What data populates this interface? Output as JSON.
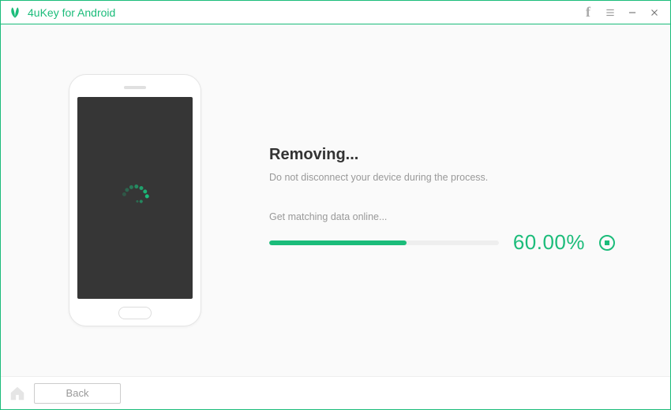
{
  "app": {
    "title": "4uKey for Android"
  },
  "titlebar": {
    "facebook": "f"
  },
  "main": {
    "heading": "Removing...",
    "subtext": "Do not disconnect your device during the process.",
    "status": "Get matching data online...",
    "progress_percent": 60.0,
    "progress_label": "60.00%"
  },
  "footer": {
    "back_label": "Back"
  },
  "colors": {
    "accent": "#1bbc7a"
  }
}
